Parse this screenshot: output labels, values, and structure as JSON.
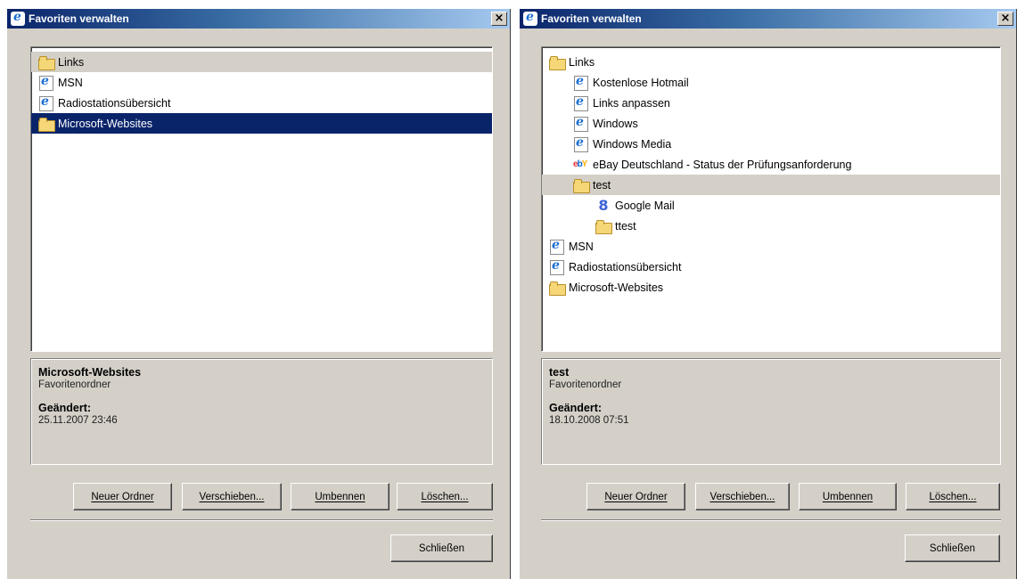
{
  "dialogs": [
    {
      "title": "Favoriten verwalten",
      "close_glyph": "×",
      "tree": [
        {
          "label": "Links",
          "icon": "folder-icon",
          "state": "hover"
        },
        {
          "label": "MSN",
          "icon": "ie-page-icon"
        },
        {
          "label": "Radiostationsübersicht",
          "icon": "ie-page-icon"
        },
        {
          "label": "Microsoft-Websites",
          "icon": "folder-icon",
          "state": "selected"
        }
      ],
      "info": {
        "name": "Microsoft-Websites",
        "type": "Favoritenordner",
        "modified_label": "Geändert:",
        "modified_value": "25.11.2007 23:46"
      },
      "buttons": {
        "new_folder": "Neuer Ordner",
        "move": "Verschieben...",
        "rename": "Umbennen",
        "delete": "Löschen...",
        "close": "Schließen"
      }
    },
    {
      "title": "Favoriten verwalten",
      "close_glyph": "×",
      "tree": [
        {
          "label": "Links",
          "icon": "folder-icon"
        },
        {
          "label": "Kostenlose Hotmail",
          "icon": "ie-page-icon"
        },
        {
          "label": "Links anpassen",
          "icon": "ie-page-icon"
        },
        {
          "label": "Windows",
          "icon": "ie-page-icon"
        },
        {
          "label": "Windows Media",
          "icon": "ie-page-icon"
        },
        {
          "label": "eBay Deutschland - Status der Prüfungsanforderung",
          "icon": "ebay-icon"
        },
        {
          "label": "test",
          "icon": "folder-icon",
          "state": "hover"
        },
        {
          "label": "Google Mail",
          "icon": "google-icon"
        },
        {
          "label": "ttest",
          "icon": "folder-icon"
        },
        {
          "label": "MSN",
          "icon": "ie-page-icon"
        },
        {
          "label": "Radiostationsübersicht",
          "icon": "ie-page-icon"
        },
        {
          "label": "Microsoft-Websites",
          "icon": "folder-icon"
        }
      ],
      "info": {
        "name": "test",
        "type": "Favoritenordner",
        "modified_label": "Geändert:",
        "modified_value": "18.10.2008 07:51"
      },
      "buttons": {
        "new_folder": "Neuer Ordner",
        "move": "Verschieben...",
        "rename": "Umbennen",
        "delete": "Löschen...",
        "close": "Schließen"
      }
    }
  ],
  "colors": {
    "dialog_bg": "#d4d0c8",
    "title_gradient_start": "#0a246a",
    "title_gradient_end": "#a6caf0",
    "selection": "#0a246a",
    "hover": "#d4d0c8"
  }
}
